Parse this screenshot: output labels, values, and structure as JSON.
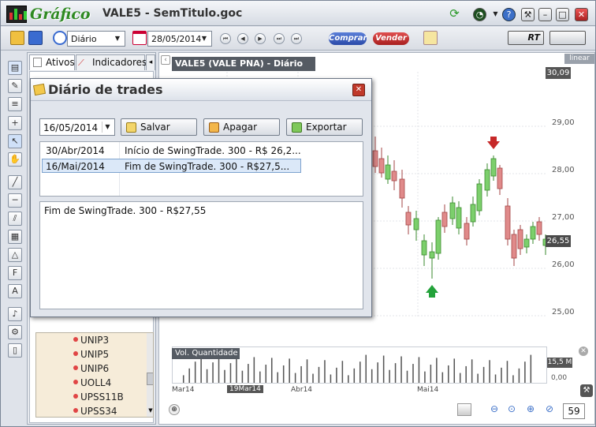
{
  "app": {
    "logo_text": "Gráfico",
    "window_title": "VALE5 - SemTitulo.goc"
  },
  "toolbar": {
    "period": "Diário",
    "date": "28/05/2014",
    "buy_label": "Comprar",
    "sell_label": "Vender",
    "rt_label": "RT"
  },
  "left_panel": {
    "tabs": [
      {
        "label": "Ativos"
      },
      {
        "label": "Indicadores"
      }
    ],
    "assets": [
      {
        "name": "UNIP3"
      },
      {
        "name": "UNIP5"
      },
      {
        "name": "UNIP6"
      },
      {
        "name": "UOLL4"
      },
      {
        "name": "UPSS11B"
      },
      {
        "name": "UPSS34"
      }
    ]
  },
  "chart": {
    "header": "VALE5 (VALE        PNA) - Diário",
    "scale_mode": "linear",
    "price_levels": [
      "29,00",
      "28,00",
      "27,00",
      "26,00",
      "25,00"
    ],
    "top_price": "30,09",
    "current_price": "26,55",
    "volume_label": "Vol. Quantidade",
    "volume_top": "15,5 M",
    "volume_bottom": "0,00",
    "time_labels": [
      "Mar14",
      "19Mar14",
      "Abr14",
      "Mai14"
    ],
    "zoom": "59",
    "colors": {
      "up": "#7ccf6c",
      "down": "#e08a8a",
      "buy_arrow": "#23a23a",
      "sell_arrow": "#c62828"
    }
  },
  "dialog": {
    "title": "Diário de trades",
    "date": "16/05/2014",
    "save_label": "Salvar",
    "delete_label": "Apagar",
    "export_label": "Exportar",
    "trades": [
      {
        "date": "30/Abr/2014",
        "text": "Início de SwingTrade. 300 - R$ 26,2..."
      },
      {
        "date": "16/Mai/2014",
        "text": "Fim de SwingTrade. 300 - R$27,5..."
      }
    ],
    "note": "Fim de SwingTrade. 300 - R$27,55"
  }
}
